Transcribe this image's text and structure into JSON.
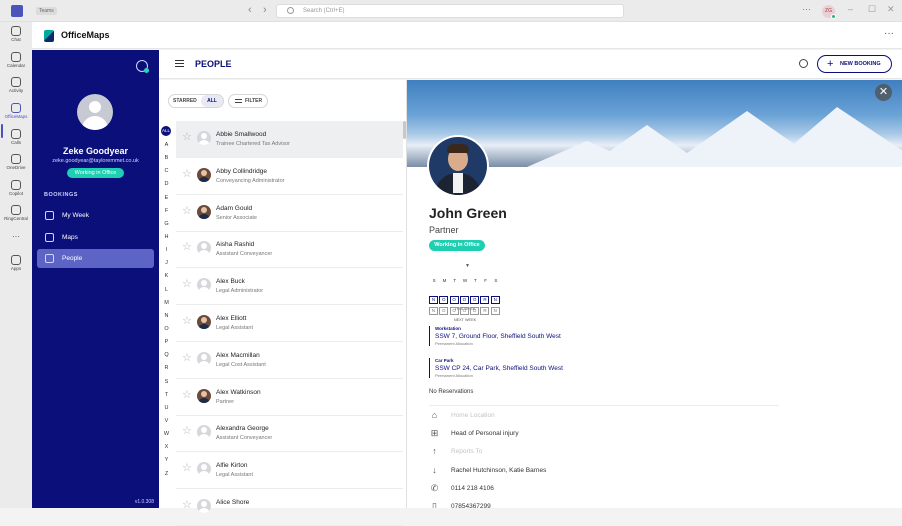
{
  "titlebar": {
    "breadcrumb": "Teams",
    "search_placeholder": "Search (Ctrl+E)",
    "avatar_initials": "ZG"
  },
  "rail": [
    {
      "label": "Chat",
      "icon": "chat-icon"
    },
    {
      "label": "Calendar",
      "icon": "calendar-icon"
    },
    {
      "label": "Activity",
      "icon": "bell-icon"
    },
    {
      "label": "OfficeMaps",
      "icon": "officemaps-icon",
      "active": true
    },
    {
      "label": "Calls",
      "icon": "phone-icon"
    },
    {
      "label": "OneDrive",
      "icon": "cloud-icon"
    },
    {
      "label": "Copilot",
      "icon": "copilot-icon"
    },
    {
      "label": "RingCentral",
      "icon": "ringcentral-icon"
    },
    {
      "label": "",
      "icon": "more-icon"
    },
    {
      "label": "Apps",
      "icon": "apps-icon"
    }
  ],
  "app": {
    "name": "OfficeMaps"
  },
  "user": {
    "name": "Zeke Goodyear",
    "email": "zeke.goodyear@tayloremmet.co.uk",
    "status": "Working in Office"
  },
  "sidebar": {
    "section": "BOOKINGS",
    "items": [
      {
        "label": "My Week",
        "icon": "calendar-icon"
      },
      {
        "label": "Maps",
        "icon": "map-icon"
      },
      {
        "label": "People",
        "icon": "people-icon",
        "active": true
      }
    ],
    "version": "v1.0.308"
  },
  "header": {
    "title": "PEOPLE",
    "new_booking": "NEW BOOKING"
  },
  "list": {
    "segments": {
      "starred": "STARRED",
      "all": "ALL"
    },
    "filter": "FILTER",
    "alphabet": [
      "ALL",
      "A",
      "B",
      "C",
      "D",
      "E",
      "F",
      "G",
      "H",
      "I",
      "J",
      "K",
      "L",
      "M",
      "N",
      "O",
      "P",
      "Q",
      "R",
      "S",
      "T",
      "U",
      "V",
      "W",
      "X",
      "Y",
      "Z"
    ],
    "people": [
      {
        "name": "Abbie Smallwood",
        "role": "Trainee Chartered Tax Advisor",
        "photo": false,
        "selected": true
      },
      {
        "name": "Abby Collindridge",
        "role": "Conveyancing Administrator",
        "photo": true
      },
      {
        "name": "Adam Gould",
        "role": "Senior Associate",
        "photo": true
      },
      {
        "name": "Aisha Rashid",
        "role": "Assistant Conveyancer",
        "photo": false
      },
      {
        "name": "Alex Buck",
        "role": "Legal Administrator",
        "photo": false
      },
      {
        "name": "Alex Elliott",
        "role": "Legal Assistant",
        "photo": true
      },
      {
        "name": "Alex Macmillan",
        "role": "Legal Cost Assistant",
        "photo": false
      },
      {
        "name": "Alex Watkinson",
        "role": "Partner",
        "photo": true
      },
      {
        "name": "Alexandra George",
        "role": "Assistant Conveyancer",
        "photo": false
      },
      {
        "name": "Alfie Kirton",
        "role": "Legal Assistant",
        "photo": false
      },
      {
        "name": "Alice Shore",
        "role": "",
        "photo": false
      }
    ]
  },
  "detail": {
    "name": "John Green",
    "title": "Partner",
    "status": "Working in Office",
    "days": [
      "S",
      "M",
      "T",
      "W",
      "T",
      "F",
      "S"
    ],
    "this_week": [
      "N",
      "O",
      "O",
      "O",
      "O",
      "R",
      "N"
    ],
    "this_week_label": "THIS WEEK",
    "next_week": [
      "N",
      "O",
      "O",
      "O",
      "O",
      "R",
      "N"
    ],
    "next_week_label": "NEXT WEEK",
    "allocations": [
      {
        "kind": "Workstation",
        "value": "SSW 7, Ground Floor, Sheffield South West",
        "note": "Permanent Allocation"
      },
      {
        "kind": "Car Park",
        "value": "SSW CP 24, Car Park, Sheffield South West",
        "note": "Permanent Allocation"
      }
    ],
    "reservations": "No Reservations",
    "info": [
      {
        "icon": "home-icon",
        "text": "Home Location",
        "placeholder": true
      },
      {
        "icon": "org-icon",
        "text": "Head of Personal injury",
        "placeholder": false
      },
      {
        "icon": "arrow-up-icon",
        "text": "Reports To",
        "placeholder": true
      },
      {
        "icon": "arrow-down-icon",
        "text": "Rachel Hutchinson,  Katie Barnes",
        "placeholder": false
      },
      {
        "icon": "phone-icon",
        "text": "0114 218 4106",
        "placeholder": false
      },
      {
        "icon": "mobile-icon",
        "text": "07854367299",
        "placeholder": false
      }
    ]
  }
}
